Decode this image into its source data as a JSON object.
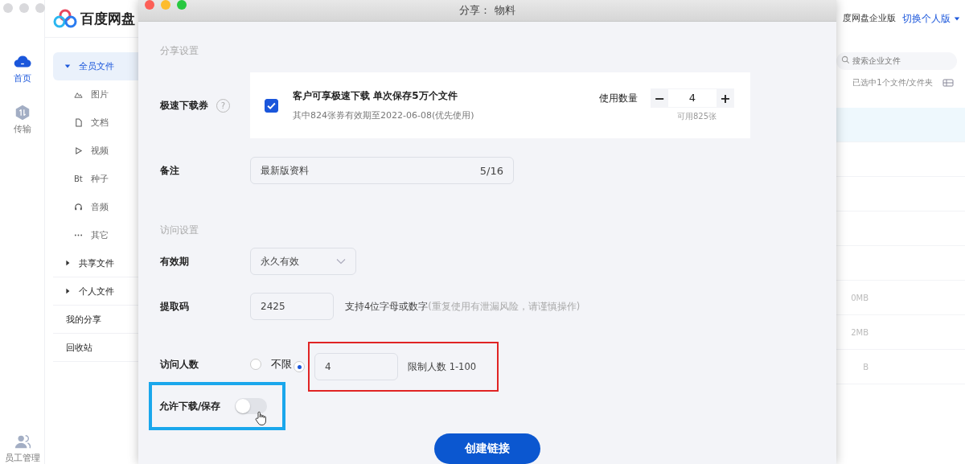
{
  "app": {
    "logo_text": "百度网盘",
    "rail": [
      {
        "label": "首页",
        "selected": true
      },
      {
        "label": "传输",
        "selected": false
      }
    ],
    "rail_bottom": "员工管理",
    "sidebar": [
      {
        "label": "全员文件",
        "kind": "group",
        "expanded": true,
        "selected": true,
        "children": [
          {
            "label": "图片",
            "kind": "image"
          },
          {
            "label": "文档",
            "kind": "doc"
          },
          {
            "label": "视频",
            "kind": "video"
          },
          {
            "label": "种子",
            "kind": "bt",
            "glyph": "Bt"
          },
          {
            "label": "音频",
            "kind": "audio"
          },
          {
            "label": "其它",
            "kind": "more"
          }
        ]
      },
      {
        "label": "共享文件",
        "kind": "group",
        "expanded": false,
        "selected": false
      },
      {
        "label": "个人文件",
        "kind": "group",
        "expanded": false,
        "selected": false
      },
      {
        "label": "我的分享",
        "kind": "link"
      },
      {
        "label": "回收站",
        "kind": "link"
      }
    ],
    "header": {
      "product": "度网盘企业版",
      "switch": "切换个人版"
    },
    "search": {
      "placeholder": "搜索企业文件"
    },
    "selection_info": "已选中1个文件/文件夹",
    "rows": [
      {
        "selected": true
      },
      {
        "selected": false
      },
      {
        "selected": false
      },
      {
        "selected": false
      },
      {
        "selected": false
      },
      {
        "size": "0MB",
        "selected": false
      },
      {
        "size": "2MB",
        "selected": false
      },
      {
        "size": "B",
        "selected": false
      }
    ]
  },
  "dialog": {
    "title": "分享： 物料",
    "share_section": "分享设置",
    "coupon": {
      "label": "极速下载券",
      "help": "?",
      "checked": true,
      "title": "客户可享极速下载 单次保存5万个文件",
      "subtitle": "其中824张券有效期至2022-06-08(优先使用)",
      "qty_label": "使用数量",
      "minus": "−",
      "qty": "4",
      "plus": "+",
      "available": "可用825张"
    },
    "note": {
      "label": "备注",
      "value": "最新版资料",
      "count": "5/16"
    },
    "access_section": "访问设置",
    "validity": {
      "label": "有效期",
      "value": "永久有效"
    },
    "code": {
      "label": "提取码",
      "value": "2425",
      "hint": "支持4位字母或数字",
      "hint_note": "(重复使用有泄漏风险，请谨慎操作)"
    },
    "visitors": {
      "label": "访问人数",
      "options": [
        {
          "label": "不限",
          "selected": false
        },
        {
          "selected": true,
          "value": "4",
          "hint": "限制人数 1-100"
        }
      ]
    },
    "allow_download": {
      "label": "允许下载/保存",
      "on": false
    },
    "create_button": "创建链接"
  }
}
